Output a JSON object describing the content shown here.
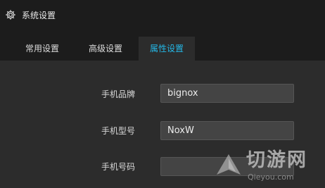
{
  "window": {
    "title": "系统设置",
    "icon": "gear-icon"
  },
  "tabs": [
    {
      "label": "常用设置",
      "active": false
    },
    {
      "label": "高级设置",
      "active": false
    },
    {
      "label": "属性设置",
      "active": true
    }
  ],
  "form": {
    "rows": [
      {
        "label": "手机品牌",
        "value": "bignox"
      },
      {
        "label": "手机型号",
        "value": "NoxW"
      },
      {
        "label": "手机号码",
        "value": ""
      }
    ]
  },
  "watermark": {
    "brand_cn": "切游网",
    "brand_en": "Qieyou.com"
  },
  "colors": {
    "accent": "#24b7e6",
    "background": "#2c2c2c",
    "titlebar": "#1c1c1c",
    "field": "#444444"
  }
}
